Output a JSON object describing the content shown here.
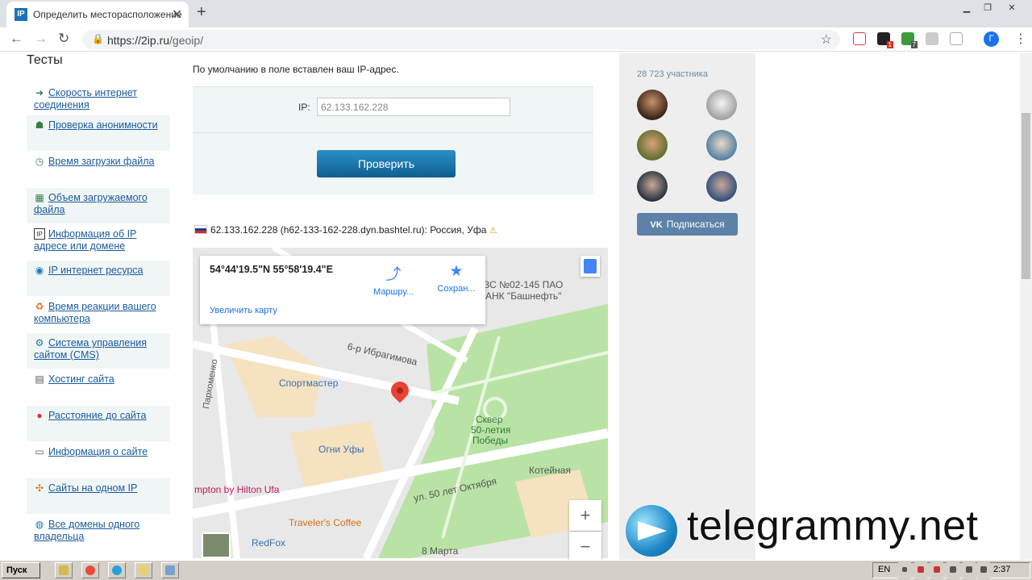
{
  "browser": {
    "tab_title": "Определить месторасположение",
    "tab_favicon": "IP",
    "close_tab": "✕",
    "new_tab": "+",
    "url_host": "https://2ip.ru",
    "url_path": "/geoip/",
    "profile_initial": "Г",
    "ext_badge_1": "1",
    "ext_badge_2": "7"
  },
  "sidebar": {
    "title": "Тесты",
    "items": [
      {
        "label": "Скорость интернет соединения",
        "icon": "speed-arrow-icon"
      },
      {
        "label": "Проверка анонимности",
        "icon": "person-icon"
      },
      {
        "label": "Время загрузки файла",
        "icon": "clock-icon"
      },
      {
        "label": "Объем загружаемого файла",
        "icon": "file-size-icon"
      },
      {
        "label": "Информация об IP адресе или домене",
        "icon": "ip-icon"
      },
      {
        "label": "IP интернет ресурса",
        "icon": "ip-resource-icon"
      },
      {
        "label": "Время реакции вашего компьютера",
        "icon": "reaction-icon"
      },
      {
        "label": "Система управления сайтом (CMS)",
        "icon": "cms-icon"
      },
      {
        "label": "Хостинг сайта",
        "icon": "hosting-icon"
      },
      {
        "label": "Расстояние до сайта",
        "icon": "pin-icon"
      },
      {
        "label": "Информация о сайте",
        "icon": "document-icon"
      },
      {
        "label": "Сайты на одном IP",
        "icon": "network-icon"
      },
      {
        "label": "Все домены одного владельца",
        "icon": "domains-icon"
      }
    ]
  },
  "main": {
    "intro": "По умолчанию в поле вставлен ваш IP-адрес.",
    "ip_label": "IP:",
    "ip_value": "62.133.162.228",
    "check_button": "Проверить",
    "result_text": "62.133.162.228 (h62-133-162-228.dyn.bashtel.ru): Россия, Уфа",
    "warning_glyph": "⚠"
  },
  "map": {
    "coordinates": "54°44'19.5\"N 55°58'19.4\"E",
    "enlarge_link": "Увеличить карту",
    "route_label": "Маршру...",
    "save_label": "Сохран...",
    "zoom_in": "+",
    "zoom_out": "−",
    "labels": {
      "azs_1": "ЗС №02-145 ПАО",
      "azs_2": "АНК \"Башнефть\"",
      "street_1": "6-р Ибрагимова",
      "sportmaster": "Спортмастер",
      "park_1": "Сквер",
      "park_2": "50-летия",
      "park_3": "Победы",
      "ogni": "Огни Уфы",
      "kotelnaya": "Котейная",
      "street_2": "ул. 50 лет Октября",
      "hampton": "mpton by Hilton Ufa",
      "travelers": "Traveler's Coffee",
      "redfox": "RedFox",
      "march": "8 Марта",
      "street_3": "Пархоменко"
    }
  },
  "right": {
    "members": "28 723 участника",
    "subscribe": "Подписаться",
    "vk_glyph": "VK"
  },
  "watermark": {
    "text": "telegrammy.net"
  },
  "taskbar": {
    "start": "Пуск",
    "lang": "EN",
    "time": "2:37"
  },
  "colors": {
    "accent_button": "#1a7bb0",
    "vk": "#5d81a8",
    "link": "#1a5a9e",
    "map_park": "#b9e3a5",
    "map_pin": "#ea4335"
  }
}
